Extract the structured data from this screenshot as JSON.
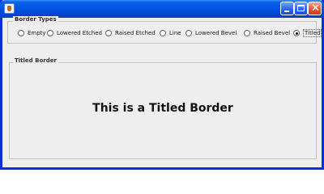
{
  "window": {
    "title": ""
  },
  "border_types": {
    "legend": "Border Types",
    "options": [
      "Empty",
      "Lowered Etched",
      "Raised Etched",
      "Line",
      "Lowered Bevel",
      "Raised Bevel",
      "Titled"
    ],
    "selected": "Titled"
  },
  "titled_panel": {
    "legend": "Titled Border",
    "content_text": "This is a Titled Border"
  }
}
